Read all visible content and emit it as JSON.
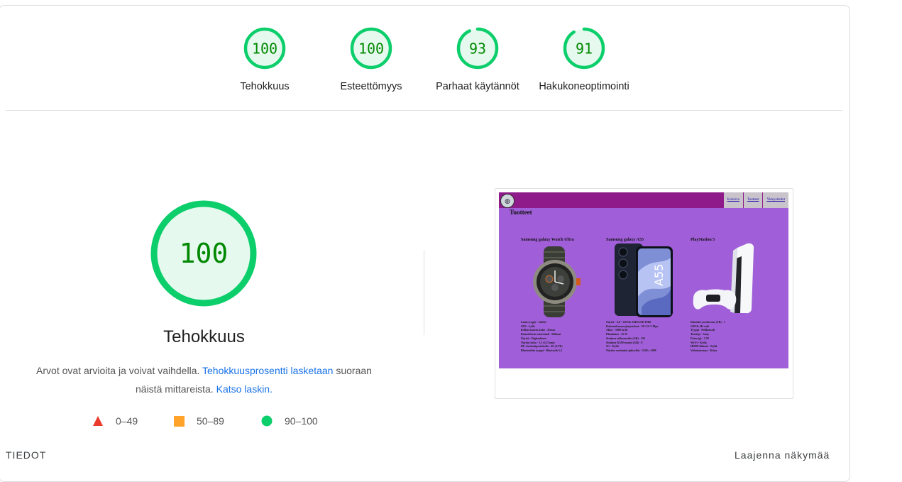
{
  "categories": [
    {
      "score": "100",
      "value": 100,
      "label": "Tehokkuus"
    },
    {
      "score": "100",
      "value": 100,
      "label": "Esteettömyys"
    },
    {
      "score": "93",
      "value": 93,
      "label": "Parhaat käytännöt"
    },
    {
      "score": "91",
      "value": 91,
      "label": "Hakukoneoptimointi"
    }
  ],
  "main": {
    "score": "100",
    "value": 100,
    "title": "Tehokkuus",
    "desc_text1": "Arvot ovat arvioita ja voivat vaihdella. ",
    "desc_link1": "Tehokkuusprosentti lasketaan",
    "desc_text2": " suoraan näistä mittareista. ",
    "desc_link2": "Katso laskin."
  },
  "legend": [
    {
      "range": "0–49",
      "shape": "triangle",
      "color": "#eb3b2f"
    },
    {
      "range": "50–89",
      "shape": "square",
      "color": "#ffa32a"
    },
    {
      "range": "90–100",
      "shape": "circle",
      "color": "#0cce6b"
    }
  ],
  "colors": {
    "pass": "#0cce6b",
    "pass_bg": "#e6f9ef",
    "pass_text": "#008800"
  },
  "screenshot": {
    "page_title": "Tuotteet",
    "nav": [
      "Kotisivu",
      "Tuotteet",
      "Yhteystiedot"
    ],
    "products": [
      {
        "name": "Samsung galaxy Watch Ultra",
        "specs": [
          "Lasin tyyppi - Safiiri",
          "GPS - kyllä",
          "Kellon kuoren koko - 47mm",
          "Rannekkeen materiaali - Silikoni",
          "Näyttö - Digitaalinen",
          "Näytön koko - 1,5 (3,37mm)",
          "RF-viestintäprotokolla - 4G (LTE)",
          "Bluetoothin tyyppi - Bluetooth 5,3"
        ]
      },
      {
        "name": "Samsung galaxy A55",
        "specs": [
          "Näyttö - 6,6\" 120 Hz AMOLED FHD",
          "Kolmoiskamerajärjestelmä - 50+12+5 Mpx",
          "Akku - 5000 mAh",
          "Pikalataus - 25 W",
          "Sisäinen tallennustila (GB) - 256",
          "Sisäinen RAM-muisti (GB) - 8",
          "5G - Kyllä",
          "Näytön resoluutio (pikseliä) - 2340 x 1080"
        ]
      },
      {
        "name": "PlayStation 5",
        "specs": [
          "Kiintolevyn tilavuus (TB) - 1",
          "120 Hz 4K-tuki",
          "Tyyppi - Pelikonsoli",
          "Tuotteja - Sony",
          "Paino (g) - 3.58",
          "Wi-Fi - Kyllä",
          "HDMI-liitäntä - Kyllä",
          "Valmistusmaa - Kiina"
        ]
      }
    ],
    "phone_text": "A55"
  },
  "footer": {
    "left": "TIEDOT",
    "right": "Laajenna näkymää"
  }
}
